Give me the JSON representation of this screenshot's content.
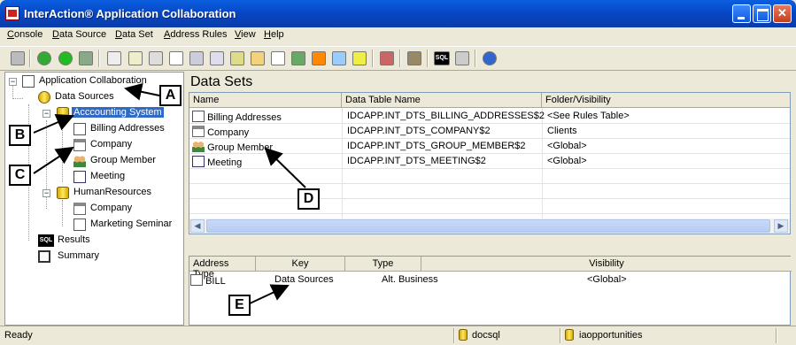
{
  "window": {
    "title": "InterAction® Application Collaboration"
  },
  "menu": [
    "Console",
    "Data Source",
    "Data Set",
    "Address Rules",
    "View",
    "Help"
  ],
  "tree": {
    "root": "Application Collaboration",
    "data_sources": "Data Sources",
    "accounting": "Acccounting System",
    "billing": "Billing Addresses",
    "company": "Company",
    "group_member": "Group Member",
    "meeting": "Meeting",
    "hr": "HumanResources",
    "hr_company": "Company",
    "marketing": "Marketing Seminar",
    "results": "Results",
    "summary": "Summary"
  },
  "datasets": {
    "title": "Data Sets",
    "columns": [
      "Name",
      "Data Table Name",
      "Folder/Visibility"
    ],
    "rows": [
      [
        "Billing Addresses",
        "IDCAPP.INT_DTS_BILLING_ADDRESSES$2",
        "<See Rules Table>"
      ],
      [
        "Company",
        "IDCAPP.INT_DTS_COMPANY$2",
        "Clients"
      ],
      [
        "Group Member",
        "IDCAPP.INT_DTS_GROUP_MEMBER$2",
        "<Global>"
      ],
      [
        "Meeting",
        "IDCAPP.INT_DTS_MEETING$2",
        "<Global>"
      ]
    ]
  },
  "addresses": {
    "columns": [
      "Address Type",
      "Key",
      "Type",
      "Visibility"
    ],
    "rows": [
      [
        "BILL",
        "Data Sources",
        "Alt. Business",
        "<Global>"
      ]
    ]
  },
  "status": {
    "text": "Ready",
    "server": "docsql",
    "database": "iaopportunities"
  },
  "callouts": [
    "A",
    "B",
    "C",
    "D",
    "E"
  ],
  "toolbar_icons": [
    "trash-icon",
    "refresh-icon",
    "power-icon",
    "database-icon",
    "building-icon",
    "person-icon",
    "document-icon",
    "list-icon",
    "address-card-icon",
    "org-icon",
    "folder-icon",
    "page-icon",
    "group-icon",
    "mail-icon",
    "email-icon",
    "envelope-icon",
    "stop-icon",
    "gear-icon",
    "sql-icon",
    "screen-icon",
    "help-icon"
  ]
}
